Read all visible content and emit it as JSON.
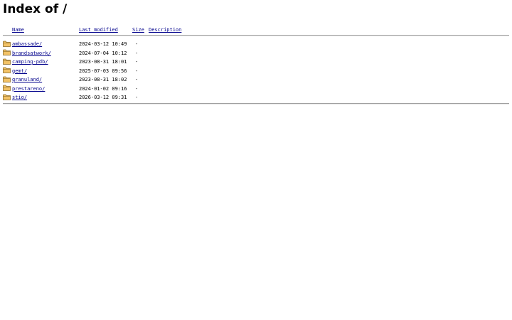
{
  "page": {
    "title": "Index of /"
  },
  "columns": {
    "name": "Name",
    "last_modified": "Last modified",
    "size": "Size",
    "description": "Description"
  },
  "icon_name": "folder-icon",
  "colors": {
    "link": "#00008b",
    "folder_fill": "#f2c266",
    "folder_stroke": "#8a6a25"
  },
  "entries": [
    {
      "name": "ambassade/",
      "modified": "2024-03-12 10:49",
      "size": "-",
      "description": ""
    },
    {
      "name": "brandsatwork/",
      "modified": "2024-07-04 10:12",
      "size": "-",
      "description": ""
    },
    {
      "name": "camping-pdb/",
      "modified": "2023-08-31 18:01",
      "size": "-",
      "description": ""
    },
    {
      "name": "gemt/",
      "modified": "2025-07-03 09:56",
      "size": "-",
      "description": ""
    },
    {
      "name": "granuland/",
      "modified": "2023-08-31 18:02",
      "size": "-",
      "description": ""
    },
    {
      "name": "prestareno/",
      "modified": "2024-01-02 09:16",
      "size": "-",
      "description": ""
    },
    {
      "name": "stio/",
      "modified": "2026-03-12 09:31",
      "size": "-",
      "description": ""
    }
  ]
}
